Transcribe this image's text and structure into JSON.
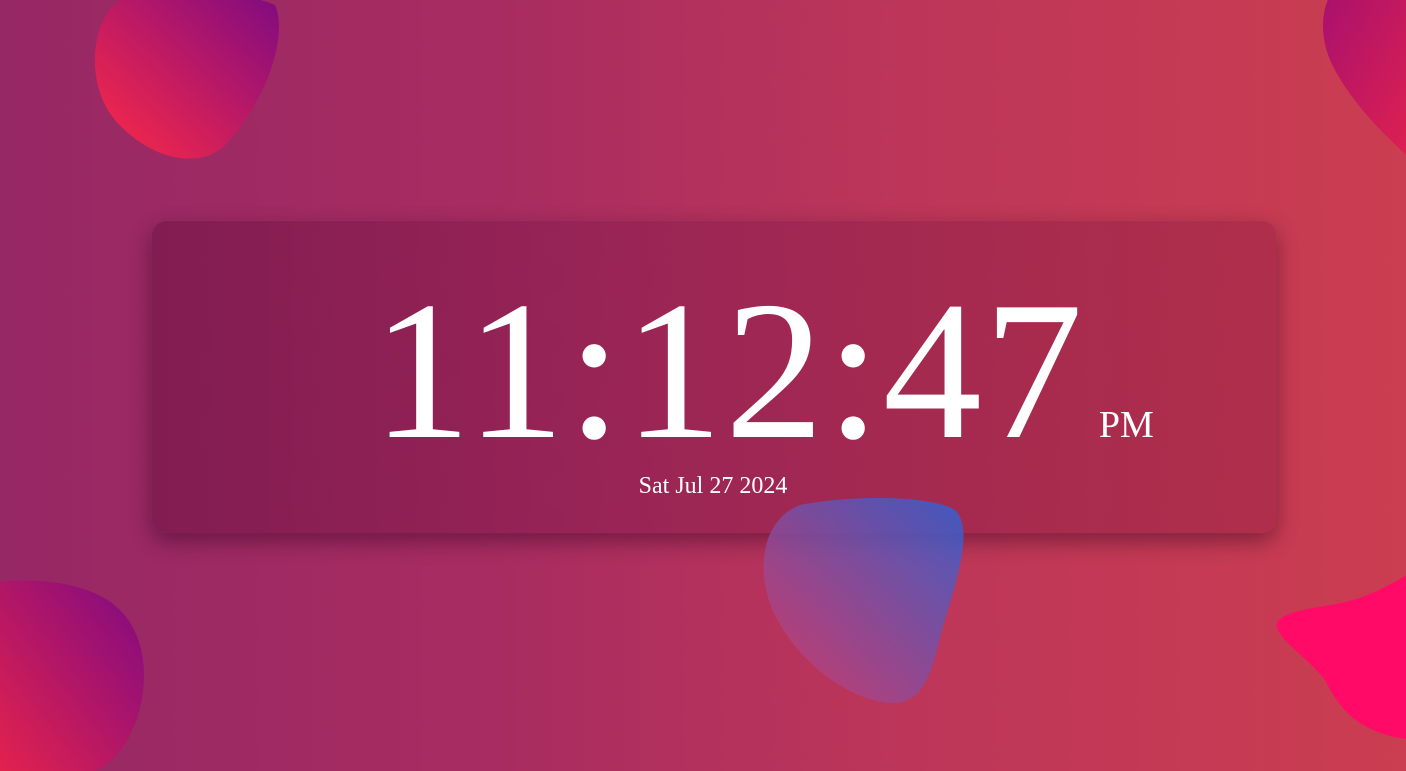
{
  "clock": {
    "time": "11:12:47",
    "period": "PM",
    "date": "Sat Jul 27 2024"
  },
  "theme": {
    "background_start": "#962865",
    "background_end": "#cb3d50",
    "blob_pink": "#e8234a",
    "blob_purple": "#850a80",
    "blob_hot_pink": "#ff0a66",
    "blob_blue": "#2f66d6",
    "text_color": "#ffffff"
  }
}
